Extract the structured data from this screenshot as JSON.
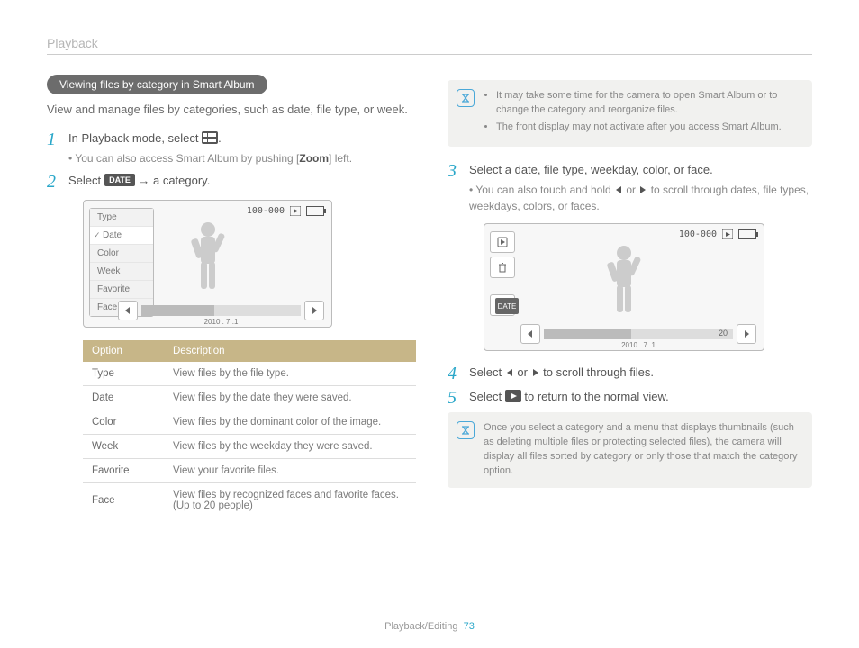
{
  "header": "Playback",
  "pill": "Viewing files by category in Smart Album",
  "intro": "View and manage files by categories, such as date, file type, or week.",
  "steps_left": [
    {
      "num": "1",
      "main_prefix": "In Playback mode, select ",
      "main_suffix": ".",
      "sub_prefix": "You can also access Smart Album by pushing [",
      "sub_zoom": "Zoom",
      "sub_suffix": "] left."
    },
    {
      "num": "2",
      "main_prefix": "Select ",
      "main_mid": " → a category.",
      "sub": null
    }
  ],
  "ss1": {
    "items": [
      "Type",
      "Date",
      "Color",
      "Week",
      "Favorite",
      "Face"
    ],
    "selected": 1,
    "top_label": "100-000",
    "date_label": "2010 . 7 .1"
  },
  "table": {
    "headers": [
      "Option",
      "Description"
    ],
    "rows": [
      [
        "Type",
        "View files by the file type."
      ],
      [
        "Date",
        "View files by the date they were saved."
      ],
      [
        "Color",
        "View files by the dominant color of the image."
      ],
      [
        "Week",
        "View files by the weekday they were saved."
      ],
      [
        "Favorite",
        "View your favorite files."
      ],
      [
        "Face",
        "View files by recognized faces and favorite faces. (Up to 20 people)"
      ]
    ]
  },
  "note1": [
    "It may take some time for the camera to open Smart Album or to change the category and reorganize files.",
    "The front display may not activate after you access Smart Album."
  ],
  "steps_right": [
    {
      "num": "3",
      "main": "Select a date, file type, weekday, color, or face.",
      "sub_prefix": "You can also touch and hold ",
      "sub_mid": " or ",
      "sub_suffix": " to scroll through dates, file types, weekdays, colors, or faces."
    }
  ],
  "ss2": {
    "top_label": "100-000",
    "date_chip": "DATE",
    "count": "20",
    "date_label": "2010 . 7 .1"
  },
  "steps_right2": [
    {
      "num": "4",
      "prefix": "Select ",
      "mid": " or ",
      "suffix": " to scroll through files."
    },
    {
      "num": "5",
      "prefix": "Select ",
      "suffix": " to return to the normal view."
    }
  ],
  "note2": "Once you select a category and a menu that displays thumbnails (such as deleting multiple files or protecting selected files), the camera will display all files sorted by category or only those that match the category option.",
  "footer": {
    "section": "Playback/Editing",
    "page": "73"
  }
}
